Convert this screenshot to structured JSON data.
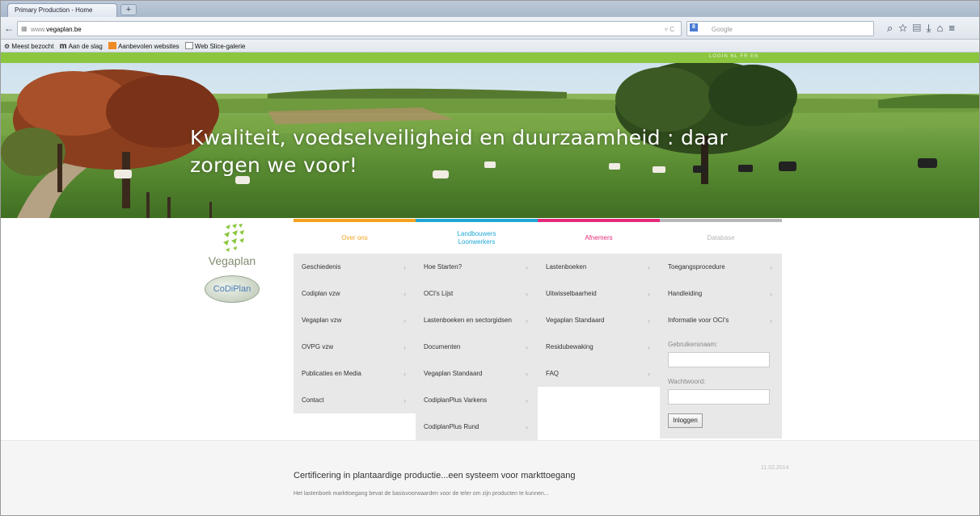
{
  "browser": {
    "tab_title": "Primary Production - Home",
    "new_tab": "+",
    "url_prefix": "www.",
    "url_domain": "vegaplan.be",
    "search_placeholder": "Google",
    "search_engine_badge": "8",
    "bookmarks": [
      {
        "label": "Meest bezocht"
      },
      {
        "label": "Aan de slag"
      },
      {
        "label": "Aanbevolen websites"
      },
      {
        "label": "Web Slice-galerie"
      }
    ]
  },
  "site": {
    "topbar_links": "LOGIN   NL  FR  EN",
    "hero_heading": "Kwaliteit, voedselveiligheid en duurzaamheid : daar zorgen we voor!",
    "logo_name": "Vegaplan",
    "codiplan_logo": "CoDiPlan",
    "columns": [
      {
        "heading": "Over ons",
        "color": "#f4a21b",
        "items": [
          "Geschiedenis",
          "Codiplan vzw",
          "Vegaplan vzw",
          "OVPG vzw",
          "Publicaties en Media",
          "Contact"
        ]
      },
      {
        "heading": "Landbouwers\nLoonwerkers",
        "color": "#1ea7d6",
        "items": [
          "Hoe Starten?",
          "OCI's Lijst",
          "Lastenboeken en sectorgidsen",
          "Documenten",
          "Vegaplan Standaard",
          "CodiplanPlus Varkens",
          "CodiplanPlus Rund"
        ]
      },
      {
        "heading": "Afnemers",
        "color": "#e6287a",
        "items": [
          "Lastenboeken",
          "Uitwisselbaarheid",
          "Vegaplan Standaard",
          "Residubewaking",
          "FAQ"
        ]
      },
      {
        "heading": "Database",
        "color": "#b7b7b7",
        "items": [
          "Toegangsprocedure",
          "Handleiding",
          "Informatie voor OCI's"
        ],
        "username_label": "Gebruikersnaam:",
        "password_label": "Wachtwoord:",
        "login_button": "Inloggen"
      }
    ],
    "news": {
      "date": "11.02.2014",
      "title": "Certificering in plantaardige productie...een systeem voor markttoegang",
      "excerpt": "Het lastenboek markttoegang bevat de basisvoorwaarden voor de teler om zijn producten te kunnen..."
    }
  }
}
